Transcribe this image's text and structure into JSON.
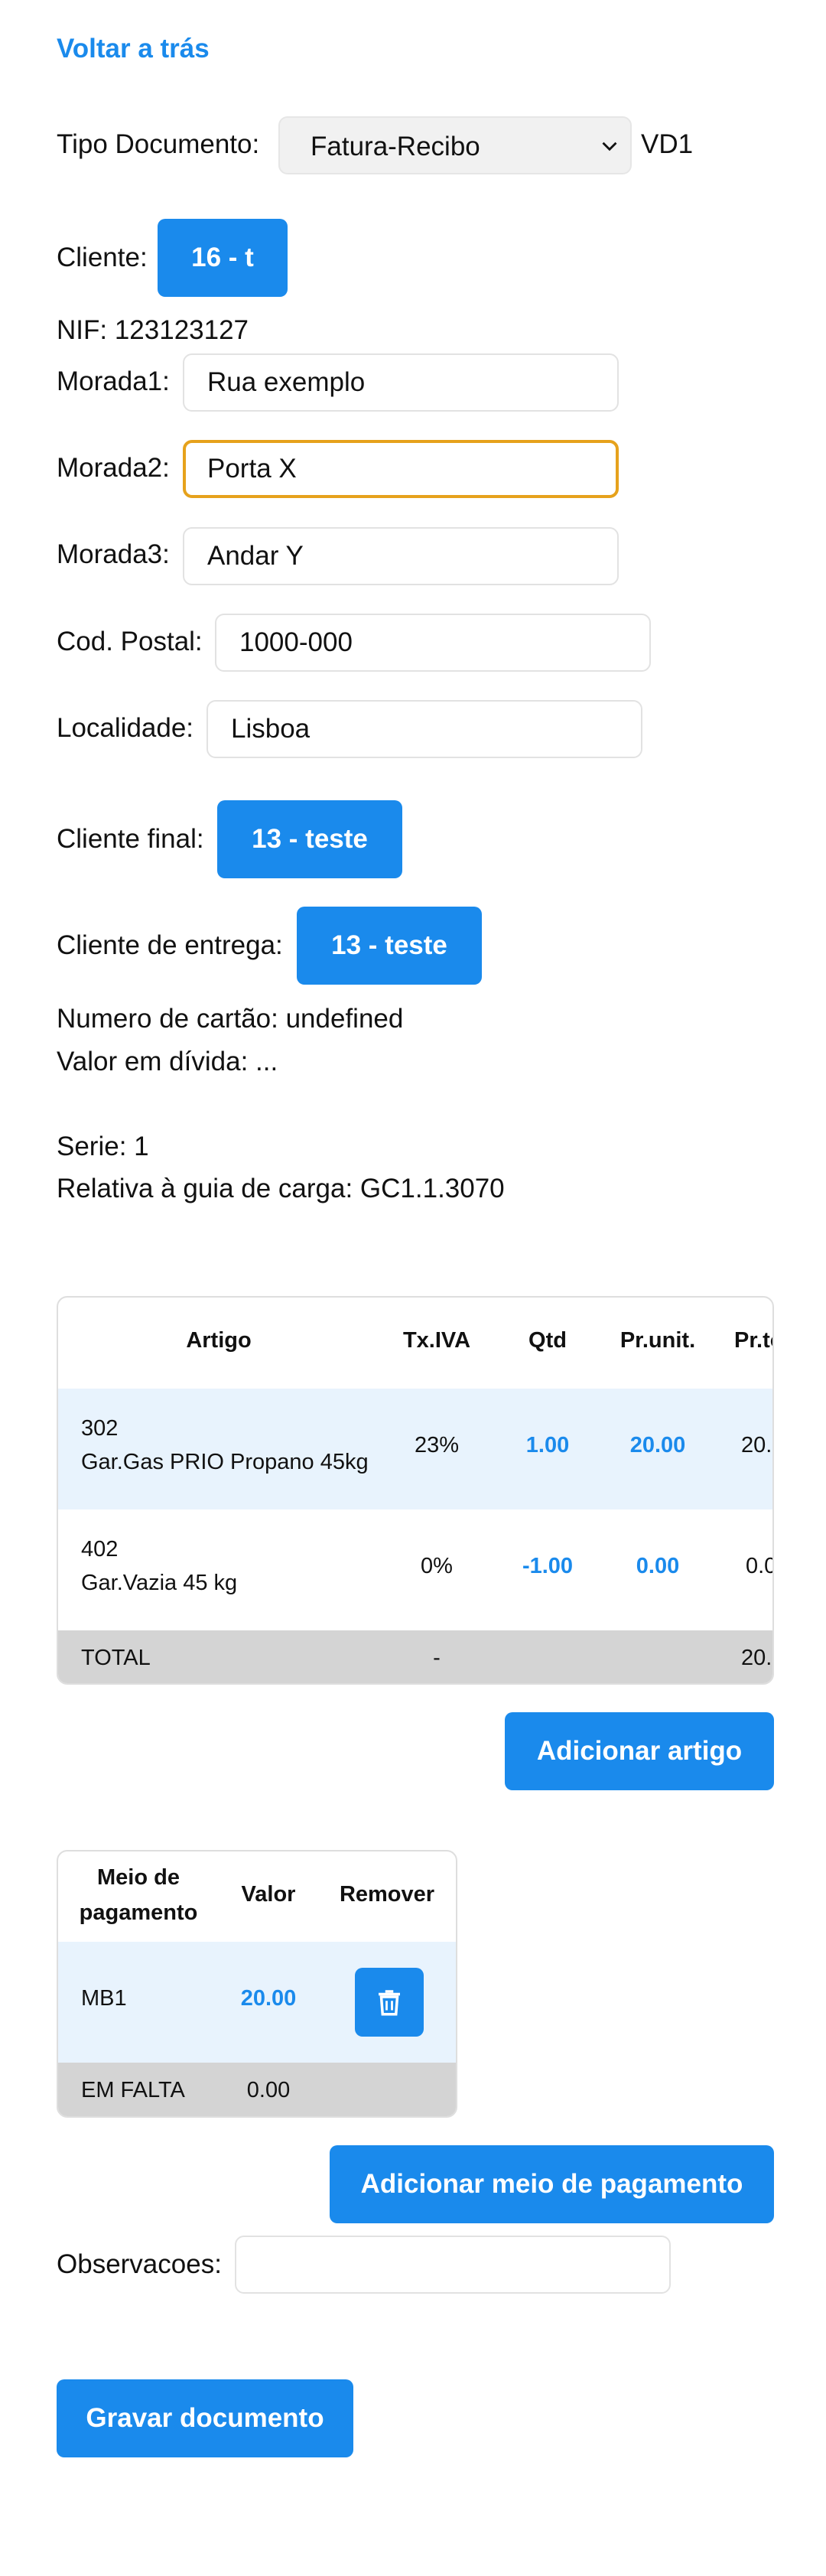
{
  "nav": {
    "back_label": "Voltar a trás"
  },
  "doc": {
    "tipo_label": "Tipo Documento:",
    "tipo_value": "Fatura-Recibo",
    "tipo_code": "VD1"
  },
  "cliente": {
    "label": "Cliente:",
    "button": "16 - t",
    "nif": "NIF: 123123127",
    "morada1_label": "Morada1:",
    "morada1_value": "Rua exemplo",
    "morada2_label": "Morada2:",
    "morada2_value": "Porta X",
    "morada3_label": "Morada3:",
    "morada3_value": "Andar Y",
    "codpostal_label": "Cod. Postal:",
    "codpostal_value": "1000-000",
    "localidade_label": "Localidade:",
    "localidade_value": "Lisboa",
    "final_label": "Cliente final:",
    "final_button": "13 - teste",
    "entrega_label": "Cliente de entrega:",
    "entrega_button": "13 - teste",
    "cartao": "Numero de cartão: undefined",
    "divida": "Valor em dívida: ..."
  },
  "info": {
    "serie": "Serie: 1",
    "guia": "Relativa à guia de carga: GC1.1.3070"
  },
  "artigos": {
    "headers": {
      "artigo": "Artigo",
      "txiva": "Tx.IVA",
      "qtd": "Qtd",
      "prunit": "Pr.unit.",
      "prtotal": "Pr.to"
    },
    "rows": [
      {
        "code": "302",
        "desc": "Gar.Gas PRIO Propano 45kg",
        "txiva": "23%",
        "qtd": "1.00",
        "prunit": "20.00",
        "prtotal": "20."
      },
      {
        "code": "402",
        "desc": "Gar.Vazia 45 kg",
        "txiva": "0%",
        "qtd": "-1.00",
        "prunit": "0.00",
        "prtotal": "0.0"
      }
    ],
    "total": {
      "label": "TOTAL",
      "txiva": "-",
      "prtotal": "20."
    },
    "add_button": "Adicionar artigo"
  },
  "pagamentos": {
    "headers": {
      "meio_line1": "Meio de",
      "meio_line2": "pagamento",
      "valor": "Valor",
      "remover": "Remover"
    },
    "rows": [
      {
        "meio": "MB1",
        "valor": "20.00"
      }
    ],
    "falta": {
      "label": "EM FALTA",
      "valor": "0.00"
    },
    "add_button": "Adicionar meio de pagamento"
  },
  "observacoes": {
    "label": "Observacoes:",
    "value": ""
  },
  "gravar_button": "Gravar documento",
  "colors": {
    "accent": "#1a8aec",
    "focus": "#e6a21c",
    "row_highlight": "#e8f3fd",
    "total_row": "#d4d4d4"
  }
}
